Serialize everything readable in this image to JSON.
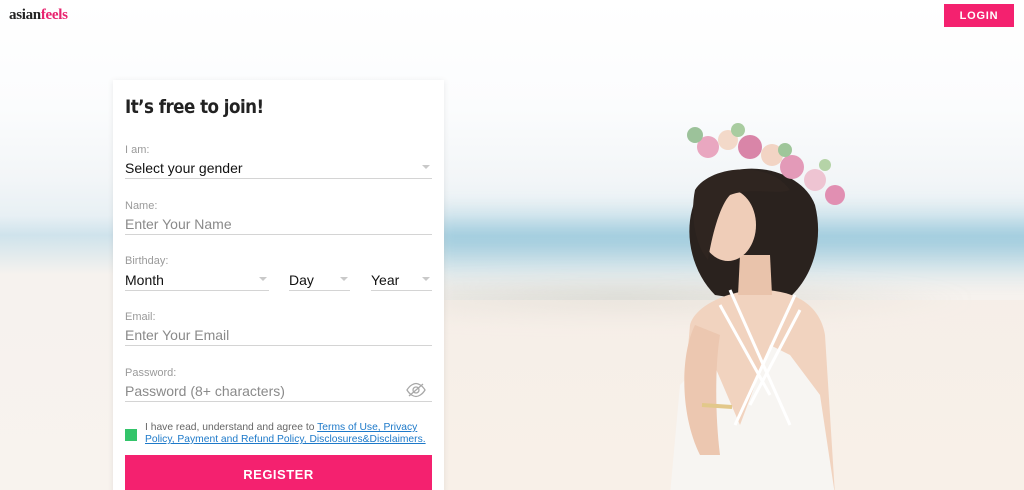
{
  "header": {
    "logo_part1": "asian",
    "logo_part2": "feels",
    "login_label": "LOGIN"
  },
  "form": {
    "title": "It’s free to join!",
    "gender": {
      "label": "I am:",
      "value": "Select your gender"
    },
    "name": {
      "label": "Name:",
      "placeholder": "Enter Your Name"
    },
    "birthday": {
      "label": "Birthday:",
      "month": "Month",
      "day": "Day",
      "year": "Year"
    },
    "email": {
      "label": "Email:",
      "placeholder": "Enter Your Email"
    },
    "password": {
      "label": "Password:",
      "placeholder": "Password (8+ characters)"
    },
    "terms": {
      "prefix": "I have read, understand and agree to ",
      "link1": "Terms of Use, Privacy Policy, Payment and Refund Policy, Disclosures&Disclaimers.",
      "checked": true
    },
    "register_label": "REGISTER"
  },
  "colors": {
    "brand": "#f4216f",
    "checkbox": "#33c46a",
    "link": "#1d79c9"
  },
  "icons": {
    "password_toggle": "eye-slash-icon",
    "dropdown": "chevron-down-icon"
  }
}
